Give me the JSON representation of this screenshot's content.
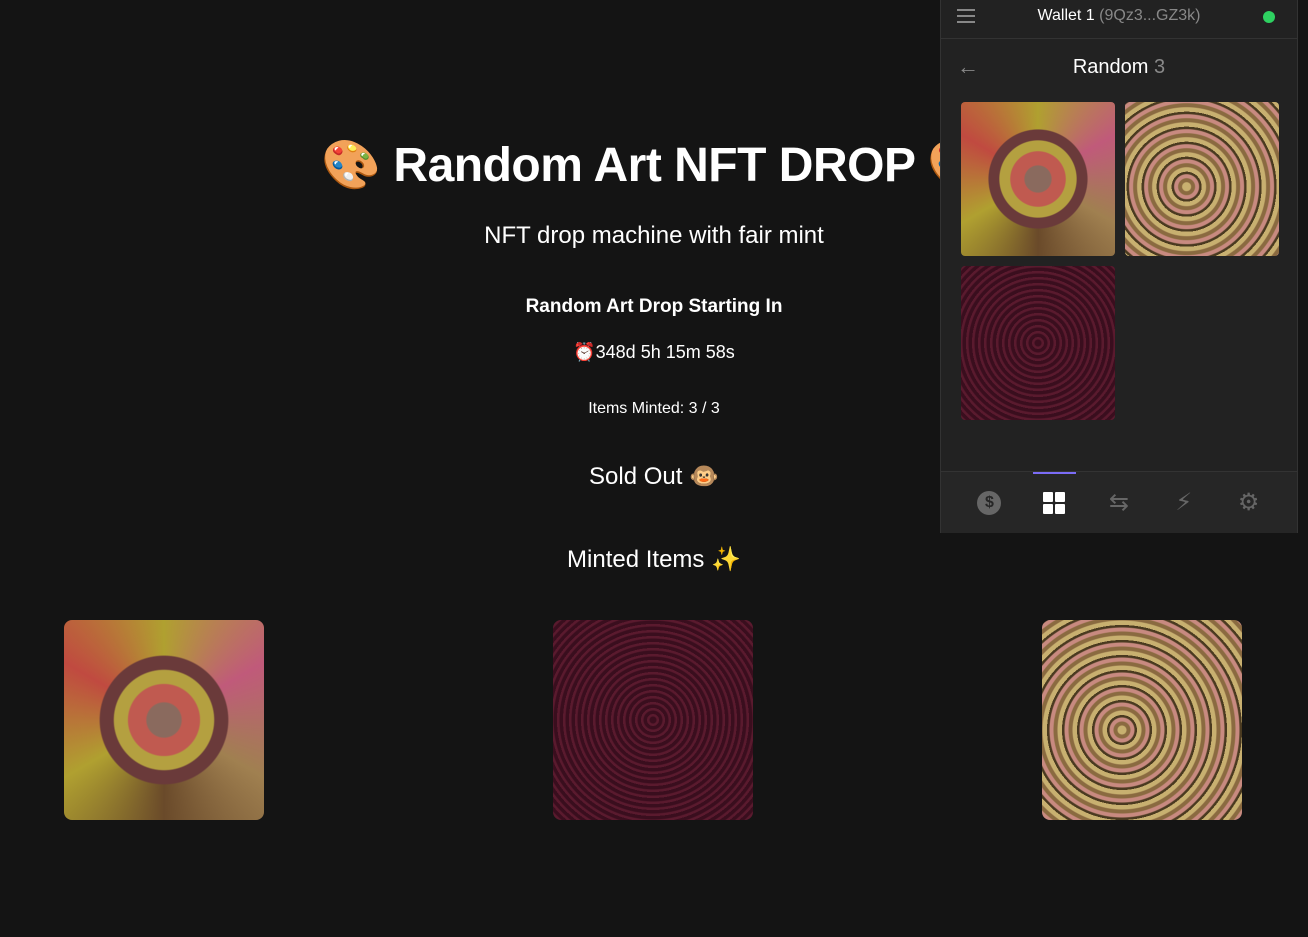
{
  "main": {
    "title": "🎨 Random Art NFT DROP 🎨",
    "subtitle": "NFT drop machine with fair mint",
    "drop_heading": "Random Art Drop Starting In",
    "countdown": "⏰348d 5h 15m 58s",
    "items_minted": "Items Minted: 3 / 3",
    "status": "Sold Out 🐵",
    "minted_heading": "Minted Items ✨"
  },
  "wallet": {
    "name": "Wallet 1",
    "address": "(9Qz3...GZ3k)",
    "status_color": "#2ed161",
    "collection": "Random",
    "count": "3",
    "tabs": [
      {
        "icon": "dollar-coin-icon"
      },
      {
        "icon": "grid-icon",
        "active": true
      },
      {
        "icon": "swap-icon"
      },
      {
        "icon": "lightning-icon"
      },
      {
        "icon": "gear-icon"
      }
    ],
    "accent": "#7b6cf6"
  }
}
